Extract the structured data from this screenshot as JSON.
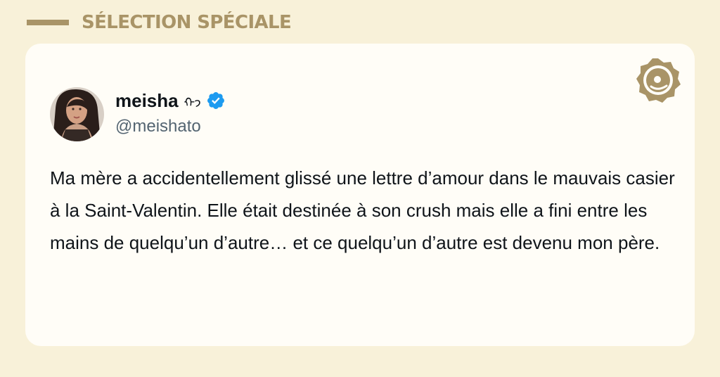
{
  "section": {
    "title": "SÉLECTION SPÉCIALE"
  },
  "colors": {
    "background": "#f8f1d9",
    "accent": "#a99467",
    "card": "#fffdf7",
    "verified": "#1d9bf0"
  },
  "tweet": {
    "author": {
      "display_name": "meisha",
      "name_emoji": "ᡣ𐭩",
      "handle": "@meishato",
      "verified": true
    },
    "text": "Ma mère a accidentellement glissé une lettre d’amour dans le mauvais casier à la Saint-Valentin. Elle était destinée à son crush mais elle a fini entre les mains de quelqu’un d’autre… et ce quelqu’un d’autre est devenu mon père."
  },
  "icons": {
    "brand": "sun-face-logo-icon",
    "verified": "verified-badge-icon"
  }
}
